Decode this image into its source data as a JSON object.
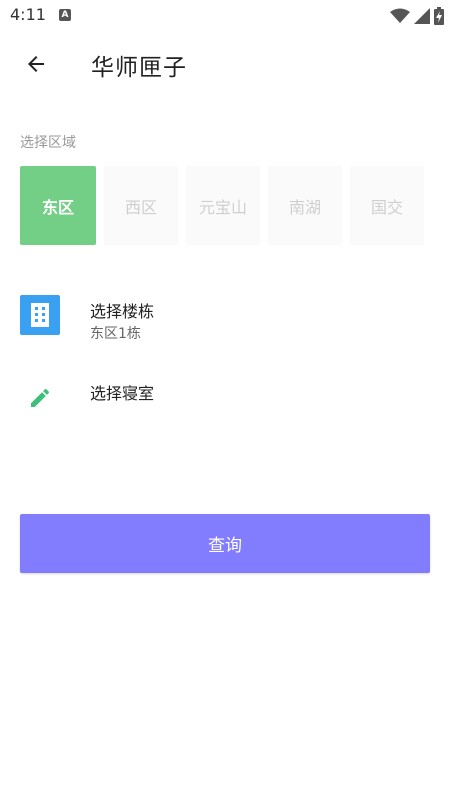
{
  "status_bar": {
    "time": "4:11",
    "notification_icon_letter": "A",
    "icons": [
      "wifi-icon",
      "signal-icon",
      "battery-charging-icon"
    ]
  },
  "toolbar": {
    "back_icon": "arrow-left-icon",
    "title": "华师匣子"
  },
  "region_section": {
    "label": "选择区域",
    "regions": [
      {
        "label": "东区",
        "selected": true
      },
      {
        "label": "西区",
        "selected": false
      },
      {
        "label": "元宝山",
        "selected": false
      },
      {
        "label": "南湖",
        "selected": false
      },
      {
        "label": "国交",
        "selected": false
      }
    ]
  },
  "options": {
    "building": {
      "icon": "building-icon",
      "title": "选择楼栋",
      "value": "东区1栋"
    },
    "dorm": {
      "icon": "pencil-icon",
      "title": "选择寝室"
    }
  },
  "query_button": {
    "label": "查询"
  },
  "colors": {
    "selected_chip": "#73cf85",
    "unselected_chip_bg": "#fafafa",
    "unselected_chip_text": "#cfcfcf",
    "building_icon_bg": "#3aa0f2",
    "pencil_icon": "#3dbf7a",
    "query_button": "#827cff"
  }
}
